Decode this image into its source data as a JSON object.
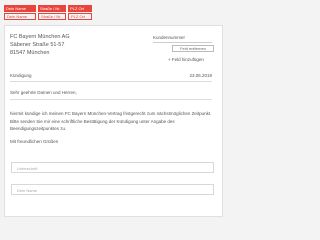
{
  "tags": {
    "row1": [
      "Dein Name",
      "Straße / Nr.",
      "PLZ Ort"
    ],
    "row2": [
      "Dein Name",
      "Straße / Nr.",
      "PLZ Ort"
    ]
  },
  "address": {
    "line1": "FC Bayern München AG",
    "line2": "Säbener Straße 51-57",
    "line3": "81547 München"
  },
  "kundennummer": {
    "label": "Kundennummer",
    "button": "Feld entfernen",
    "add_field": "+ Feld hinzufügen"
  },
  "kuendigung": {
    "label": "Kündigung",
    "date": "23.05.2019"
  },
  "letter": {
    "salutation": "Sehr geehrte Damen und Herren,",
    "body": "hiermit kündige ich meinen FC Bayern München-Vertrag fristgerecht zum nächstmöglichen Zeitpunkt. Bitte senden Sie mir eine schriftliche Bestätigung der Kündigung unter Angabe des Beendigungszeitpunktes zu.",
    "closing": "Mit freundlichen Grüßen"
  },
  "inputs": {
    "signature_placeholder": "Unterschrift",
    "name_placeholder": "Dein Name"
  },
  "colors": {
    "accent": "#e8453c"
  }
}
